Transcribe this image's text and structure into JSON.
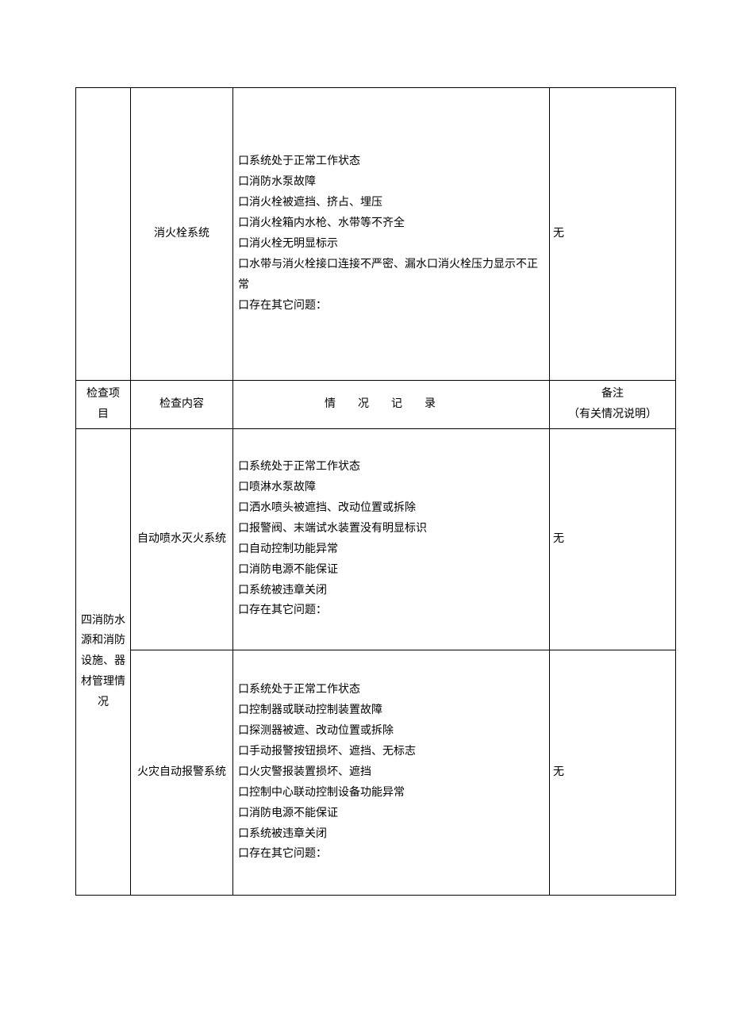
{
  "row1": {
    "project": "",
    "content": "消火栓系统",
    "record": [
      "口系统处于正常工作状态",
      "口消防水泵故障",
      "口消火栓被遮挡、挤占、埋压",
      "口消火栓箱内水枪、水带等不齐全",
      "口消火栓无明显标示",
      "口水带与消火栓接口连接不严密、漏水口消火栓压力显示不正常",
      "口存在其它问题："
    ],
    "remark": "无"
  },
  "header": {
    "project_l1": "检查项",
    "project_l2": "目",
    "content": "检查内容",
    "record": "情况记录",
    "remark_l1": "备注",
    "remark_l2": "（有关情况说明）"
  },
  "section": {
    "project": "四消防水源和消防设施、器材管理情况"
  },
  "row2": {
    "content": "自动喷水灭火系统",
    "record": [
      "口系统处于正常工作状态",
      "口喷淋水泵故障",
      "口洒水喷头被遮挡、改动位置或拆除",
      "口报警阀、末端试水装置没有明显标识",
      "口自动控制功能异常",
      "口消防电源不能保证",
      "口系统被违章关闭",
      "口存在其它问题："
    ],
    "remark": "无"
  },
  "row3": {
    "content": "火灾自动报警系统",
    "record": [
      "口系统处于正常工作状态",
      "口控制器或联动控制装置故障",
      "口探测器被遮、改动位置或拆除",
      "口手动报警按钮损坏、遮挡、无标志",
      "口火灾警报装置损坏、遮挡",
      "口控制中心联动控制设备功能异常",
      "口消防电源不能保证",
      "口系统被违章关闭",
      "口存在其它问题："
    ],
    "remark": "无"
  }
}
